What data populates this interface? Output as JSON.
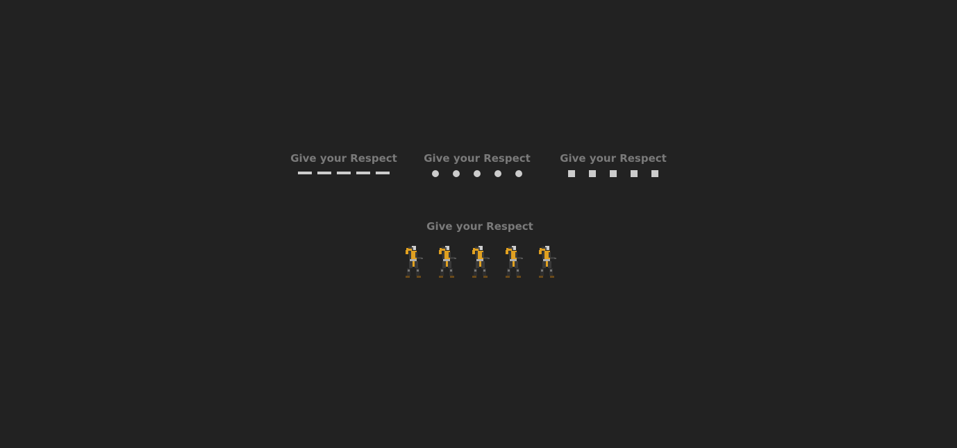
{
  "loaders": [
    {
      "title": "Give your Respect",
      "style": "dashes",
      "count": 5
    },
    {
      "title": "Give your Respect",
      "style": "dots",
      "count": 5
    },
    {
      "title": "Give your Respect",
      "style": "squares",
      "count": 5
    },
    {
      "title": "Give your Respect",
      "style": "fighter-sprites",
      "count": 5
    }
  ],
  "colors": {
    "background": "#222222",
    "title": "#7a7a7a",
    "indicator": "#cccccc",
    "sprite_yellow": "#e0a020",
    "sprite_gray": "#3a3a3a"
  }
}
